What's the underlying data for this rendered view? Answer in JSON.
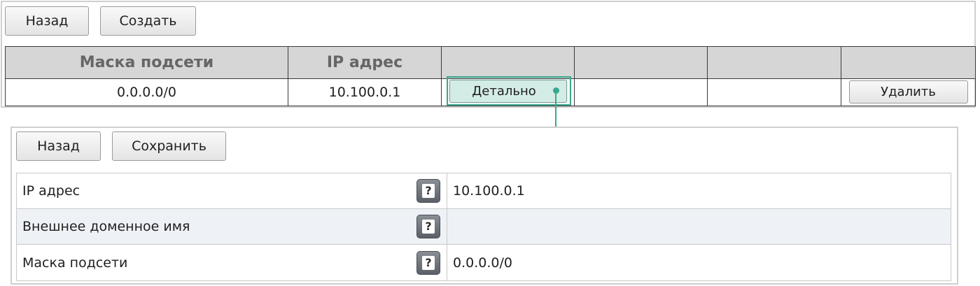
{
  "list_view": {
    "back_label": "Назад",
    "create_label": "Создать",
    "columns": [
      "Маска подсети",
      "IP адрес",
      "",
      "",
      "",
      ""
    ],
    "rows": [
      {
        "subnet_mask": "0.0.0.0/0",
        "ip_address": "10.100.0.1",
        "details_label": "Детально",
        "delete_label": "Удалить"
      }
    ]
  },
  "detail_view": {
    "back_label": "Назад",
    "save_label": "Сохранить",
    "help_glyph": "?",
    "fields": [
      {
        "label": "IP адрес",
        "value": "10.100.0.1"
      },
      {
        "label": "Внешнее доменное имя",
        "value": ""
      },
      {
        "label": "Маска подсети",
        "value": "0.0.0.0/0"
      }
    ]
  },
  "colors": {
    "highlight": "#3aa890",
    "header_bg": "#d6d6d6",
    "alt_row_bg": "#eef2f7"
  }
}
